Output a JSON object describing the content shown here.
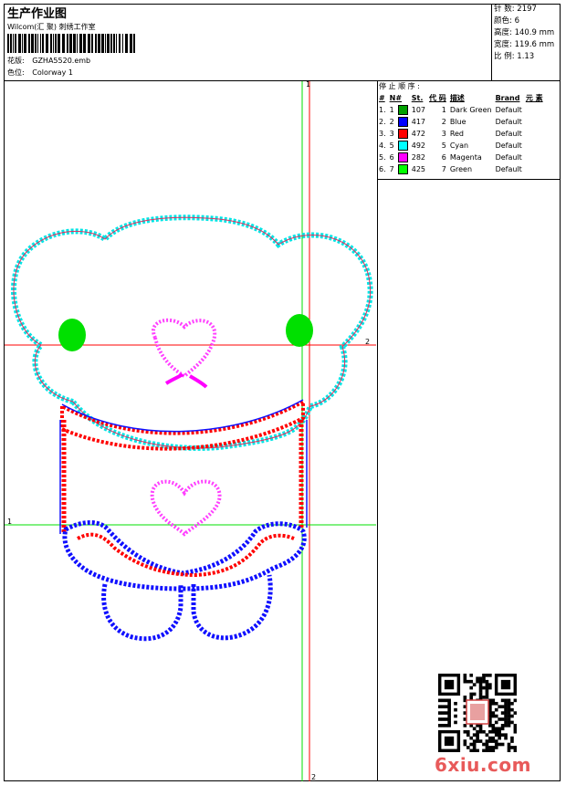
{
  "header": {
    "title": "生产作业图",
    "company": "Wilcom(汇 聚) 刺绣工作室",
    "design_label": "花版:",
    "design_file": "GZHA5520.emb",
    "colorway_label": "色位:",
    "colorway": "Colorway 1"
  },
  "stats": {
    "stitches_label": "针 数:",
    "stitches": "2197",
    "colors_label": "颜色:",
    "colors": "6",
    "height_label": "高度:",
    "height": "140.9 mm",
    "width_label": "宽度:",
    "width": "119.6 mm",
    "scale_label": "比 例:",
    "scale": "1.13"
  },
  "stop_sequence": {
    "title": "停 止 顺 序 :",
    "headers": [
      "#",
      "N#",
      "St.",
      "代 码",
      "描述",
      "Brand",
      "元 素"
    ],
    "rows": [
      {
        "idx": "1.",
        "n": "1",
        "color": "#00a000",
        "st": "107",
        "code": "1",
        "desc": "Dark Green",
        "brand": "Default"
      },
      {
        "idx": "2.",
        "n": "2",
        "color": "#0000ff",
        "st": "417",
        "code": "2",
        "desc": "Blue",
        "brand": "Default"
      },
      {
        "idx": "3.",
        "n": "3",
        "color": "#ff0000",
        "st": "472",
        "code": "3",
        "desc": "Red",
        "brand": "Default"
      },
      {
        "idx": "4.",
        "n": "5",
        "color": "#00ffff",
        "st": "492",
        "code": "5",
        "desc": "Cyan",
        "brand": "Default"
      },
      {
        "idx": "5.",
        "n": "6",
        "color": "#ff00ff",
        "st": "282",
        "code": "6",
        "desc": "Magenta",
        "brand": "Default"
      },
      {
        "idx": "6.",
        "n": "7",
        "color": "#00ff00",
        "st": "425",
        "code": "7",
        "desc": "Green",
        "brand": "Default"
      }
    ]
  },
  "guides": {
    "label_1_top": "1",
    "label_1_left": "1",
    "label_2_right": "2",
    "label_2_bottom": "2"
  },
  "watermark": "6xiu.com"
}
